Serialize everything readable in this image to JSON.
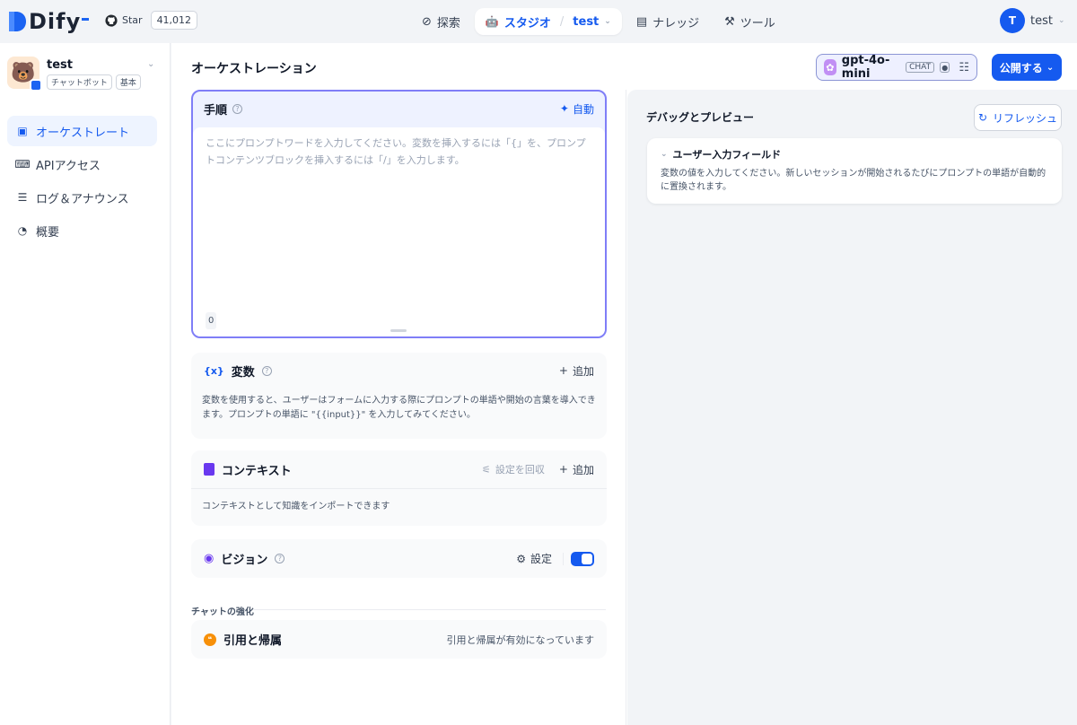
{
  "brand": {
    "name": "Dify"
  },
  "github": {
    "label": "Star",
    "count": "41,012"
  },
  "nav": {
    "explore": "探索",
    "studio": "スタジオ",
    "app_name": "test",
    "knowledge": "ナレッジ",
    "tools": "ツール"
  },
  "user": {
    "initial": "T",
    "name": "test"
  },
  "app": {
    "name": "test",
    "tags": [
      "チャットボット",
      "基本"
    ]
  },
  "sidebar": {
    "items": [
      {
        "label": "オーケストレート",
        "icon": "layout-icon"
      },
      {
        "label": "APIアクセス",
        "icon": "terminal-icon"
      },
      {
        "label": "ログ＆アナウンス",
        "icon": "log-icon"
      },
      {
        "label": "概要",
        "icon": "dashboard-icon"
      }
    ]
  },
  "main": {
    "title": "オーケストレーション",
    "model": {
      "name": "gpt-4o-mini",
      "mode": "CHAT"
    },
    "publish_label": "公開する"
  },
  "prompt": {
    "title": "手順",
    "auto_label": "自動",
    "placeholder": "ここにプロンプトワードを入力してください。変数を挿入するには「{」を、プロンプトコンテンツブロックを挿入するには「/」を入力します。",
    "char_count": "0"
  },
  "variables": {
    "title": "変数",
    "add_label": "追加",
    "description": "変数を使用すると、ユーザーはフォームに入力する際にプロンプトの単語や開始の言葉を導入できます。プロンプトの単語に \"{{input}}\" を入力してみてください。"
  },
  "context": {
    "title": "コンテキスト",
    "retrieval_label": "設定を回収",
    "add_label": "追加",
    "description": "コンテキストとして知識をインポートできます"
  },
  "vision": {
    "title": "ビジョン",
    "settings_label": "設定",
    "enabled": true
  },
  "chat_enhance": {
    "label": "チャットの強化",
    "citation": {
      "title": "引用と帰属",
      "status": "引用と帰属が有効になっています"
    }
  },
  "debug": {
    "title": "デバッグとプレビュー",
    "refresh_label": "リフレッシュ",
    "input_field": {
      "title": "ユーザー入力フィールド",
      "description": "変数の値を入力してください。新しいセッションが開始されるたびにプロンプトの単語が自動的に置換されます。"
    }
  },
  "colors": {
    "accent": "#155aef",
    "prompt_border": "#7f7ef7"
  }
}
